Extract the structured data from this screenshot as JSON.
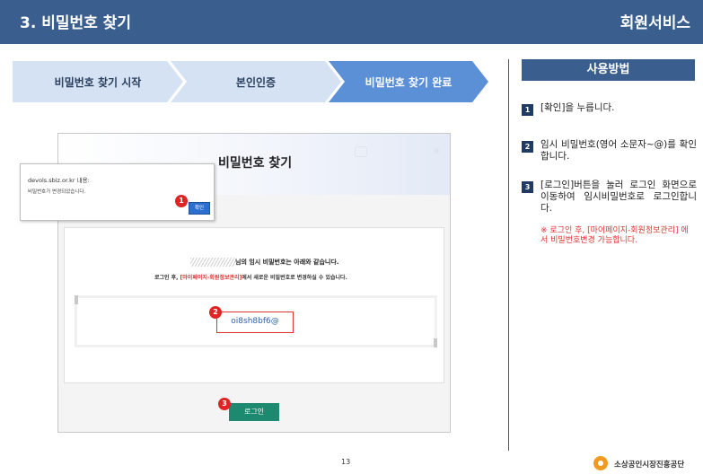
{
  "header": {
    "title": "3. 비밀번호 찾기",
    "service": "회원서비스"
  },
  "steps": [
    "비밀번호 찾기 시작",
    "본인인증",
    "비밀번호 찾기 완료"
  ],
  "guide": {
    "title": "사용방법",
    "items": [
      {
        "num": "1",
        "text": "[확인]을 누릅니다."
      },
      {
        "num": "2",
        "text": "임시 비밀번호(영어 소문자~@)를 확인합니다."
      },
      {
        "num": "3",
        "text": "[로그인]버튼을 눌러 로그인 화면으로 이동하여 임시비밀번호로 로그인합니다."
      }
    ],
    "note": "※ 로그인 후, [마이페이지-회원정보관리] 에서 비밀번호변경 가능합니다."
  },
  "panel": {
    "title": "비밀번호 찾기",
    "message1": "님의 임시 비밀번호는 아래와 같습니다.",
    "message2_pre": "로그인 후, ",
    "message2_highlight": "[마이페이지-회원정보관리]",
    "message2_post": "에서 새로운 비밀번호로 변경하실 수 있습니다.",
    "password": "oi8sh8bf6@",
    "login_button": "로그인"
  },
  "alert": {
    "source": "devols.sbiz.or.kr 내용:",
    "message": "비밀번호가 변경되었습니다.",
    "ok": "확인"
  },
  "badges": [
    "1",
    "2",
    "3"
  ],
  "footer": {
    "page": "13",
    "org": "소상공인시장진흥공단"
  },
  "colors": {
    "header": "#3a5f8f",
    "step": "#d5e2f3",
    "step_active": "#5b8fd6",
    "highlight": "#e03030",
    "button": "#1d8a6f"
  }
}
